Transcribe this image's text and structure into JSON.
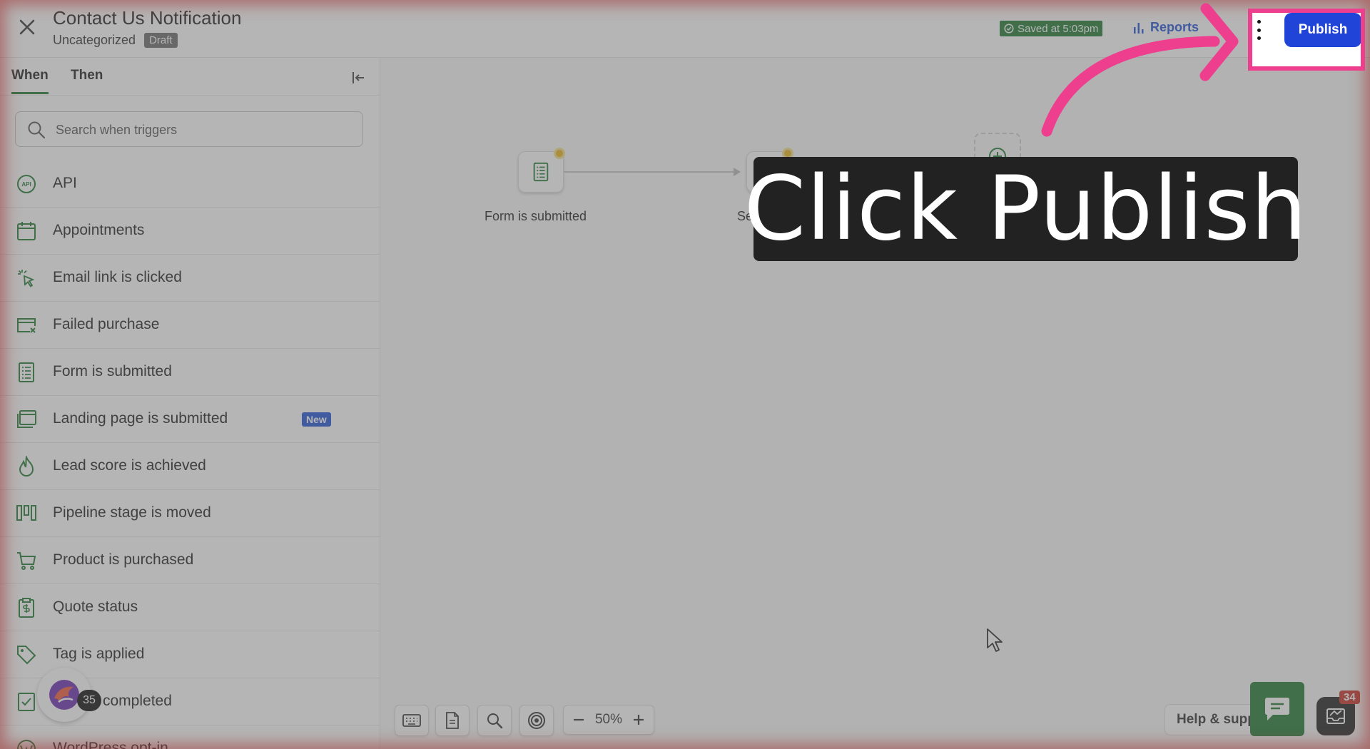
{
  "header": {
    "title": "Contact Us Notification",
    "category": "Uncategorized",
    "status_badge": "Draft",
    "saved_text": "Saved at 5:03pm",
    "reports_label": "Reports",
    "publish_label": "Publish"
  },
  "sidebar": {
    "tabs": [
      {
        "label": "When",
        "active": true
      },
      {
        "label": "Then",
        "active": false
      }
    ],
    "search_placeholder": "Search when triggers",
    "new_badge": "New",
    "items": [
      {
        "label": "API",
        "icon": "api-icon"
      },
      {
        "label": "Appointments",
        "icon": "calendar-icon"
      },
      {
        "label": "Email link is clicked",
        "icon": "click-icon"
      },
      {
        "label": "Failed purchase",
        "icon": "failed-card-icon"
      },
      {
        "label": "Form is submitted",
        "icon": "form-icon"
      },
      {
        "label": "Landing page is submitted",
        "icon": "landing-page-icon",
        "badge": "New"
      },
      {
        "label": "Lead score is achieved",
        "icon": "flame-icon"
      },
      {
        "label": "Pipeline stage is moved",
        "icon": "pipeline-icon"
      },
      {
        "label": "Product is purchased",
        "icon": "cart-icon"
      },
      {
        "label": "Quote status",
        "icon": "quote-icon"
      },
      {
        "label": "Tag is applied",
        "icon": "tag-icon"
      },
      {
        "label": "Task is completed",
        "visible_label": "completed",
        "icon": "task-icon"
      },
      {
        "label": "WordPress opt-in",
        "icon": "wordpress-icon"
      }
    ]
  },
  "canvas": {
    "nodes": [
      {
        "label": "Form is submitted",
        "icon": "form-icon"
      },
      {
        "label": "Sequence",
        "icon": "stack-icon"
      }
    ],
    "zoom_level": "50%"
  },
  "widgets": {
    "avatar_count": "35",
    "help_label": "Help & support",
    "help_visible": "Help & supp",
    "inbox_count": "34"
  },
  "overlay": {
    "instruction": "Click Publish"
  },
  "colors": {
    "brand_green": "#1f7a32",
    "publish_blue": "#2144d8",
    "highlight_pink": "#ee3e8e",
    "callout_bg": "#222222"
  }
}
